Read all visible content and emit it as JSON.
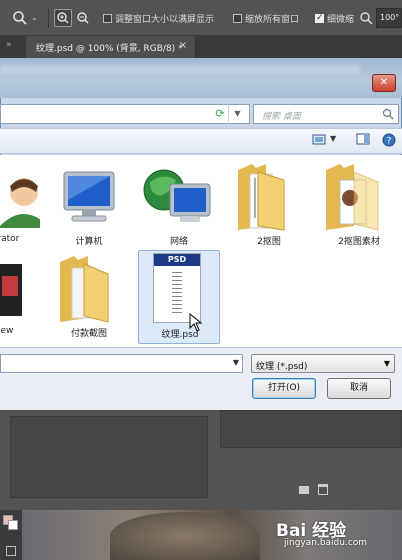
{
  "options_bar": {
    "zoom_tool": "magnifier-icon",
    "resize_windows_label": "调整窗口大小以满屏显示",
    "resize_windows_checked": false,
    "zoom_all_label": "缩放所有窗口",
    "zoom_all_checked": false,
    "scrubby_zoom_label": "细微缩",
    "scrubby_zoom_checked": true,
    "zoom_value": "100°"
  },
  "document_tab": {
    "title": "纹理.psd @ 100% (背景, RGB/8) *",
    "close": "×"
  },
  "dialog": {
    "close": "✕",
    "search_placeholder": "搜索 桌面",
    "file_items": [
      {
        "label": "istrator",
        "kind": "user"
      },
      {
        "label": "计算机",
        "kind": "computer"
      },
      {
        "label": "网络",
        "kind": "network"
      },
      {
        "label": "2抠图",
        "kind": "folder"
      },
      {
        "label": "2抠图素材",
        "kind": "folder"
      },
      {
        "label": "view",
        "kind": "photo"
      },
      {
        "label": "付款截图",
        "kind": "folder"
      },
      {
        "label": "纹理.psd",
        "kind": "psd",
        "selected": true
      },
      {
        "label": "PSD",
        "kind": "psd-badge"
      }
    ],
    "filename_value": "",
    "filetype_value": "纹理 (*.psd)",
    "open_label": "打开(O)",
    "cancel_label": "取消"
  },
  "watermark": {
    "text": "Bai 经验",
    "sub": "jingyan.baidu.com"
  },
  "colors": {
    "ps_dark": "#535353",
    "dialog_frame": "#c8d8ea",
    "selection": "#dbe9f8"
  }
}
